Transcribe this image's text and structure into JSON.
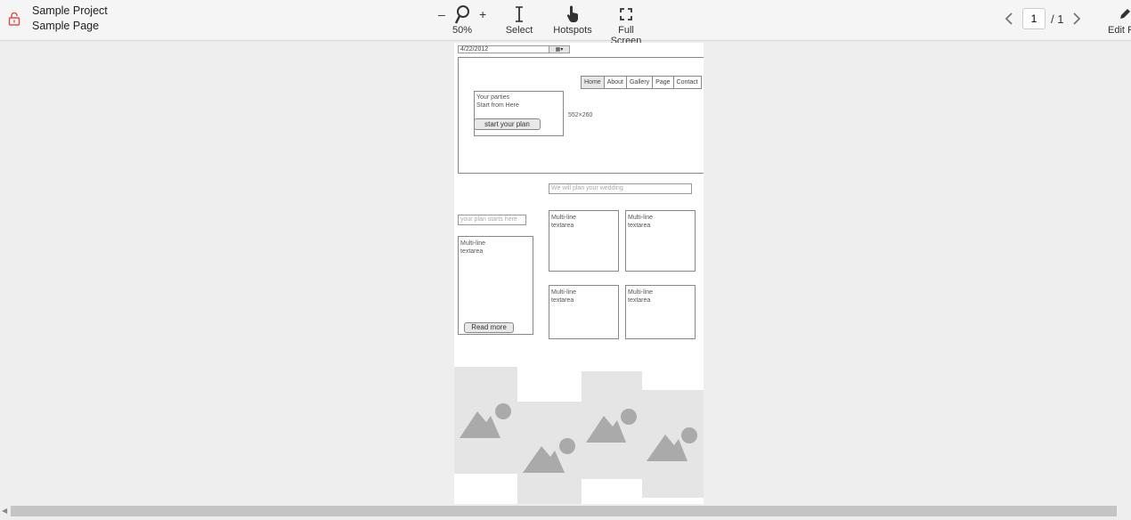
{
  "project": {
    "name": "Sample Project",
    "page": "Sample Page"
  },
  "toolbar": {
    "zoom_minus": "–",
    "zoom_plus": "+",
    "zoom_level": "50%",
    "select_label": "Select",
    "hotspots_label": "Hotspots",
    "fullscreen_label": "Full Screen",
    "edit_label": "Edit Page"
  },
  "pager": {
    "current": "1",
    "total": "/ 1"
  },
  "wireframe": {
    "date_value": "4/22/2012",
    "nav": [
      "Home",
      "About",
      "Gallery",
      "Page",
      "Contact"
    ],
    "hero_line1": "Your parties",
    "hero_line2": "Start from Here",
    "hero_button": "start your plan",
    "hero_size": "552×260",
    "wedding_placeholder": "We will plan your wedding",
    "plan_placeholder": "your plan starts here",
    "textarea_line1": "Multi-line",
    "textarea_line2": "textarea",
    "read_more": "Read more"
  },
  "colors": {
    "lock_icon": "#e05050",
    "accent_gray": "#888888"
  }
}
